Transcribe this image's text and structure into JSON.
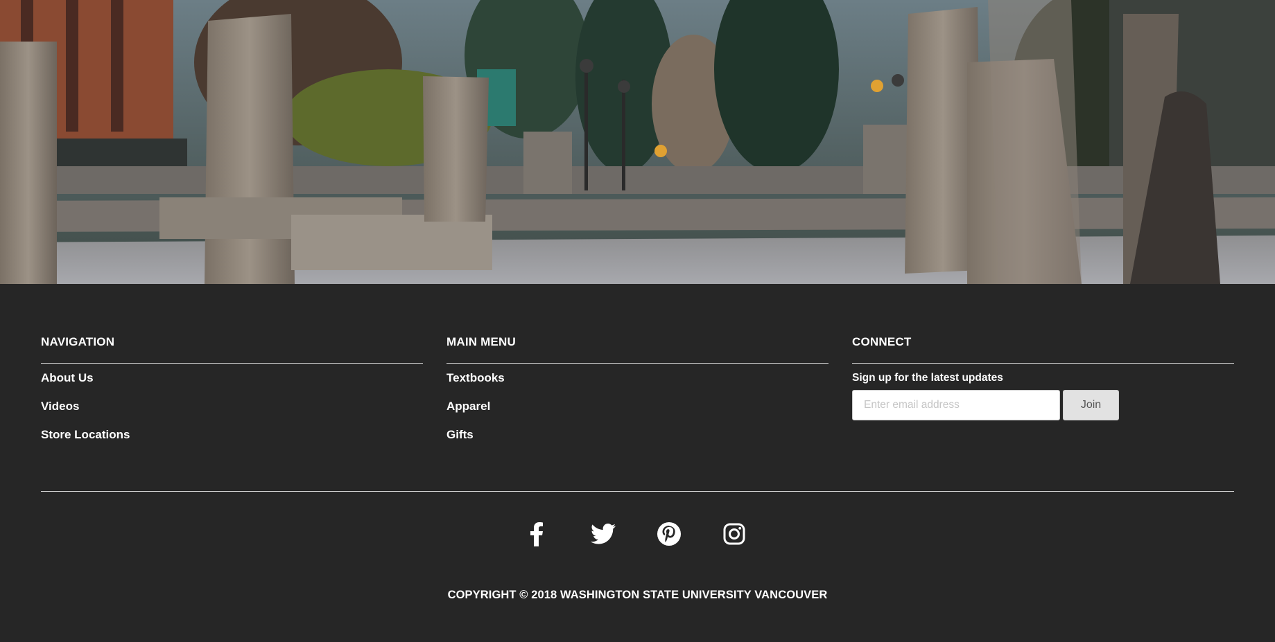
{
  "hero": {
    "image": "campus-stone-sculptures-photo"
  },
  "footer": {
    "navigation": {
      "heading": "NAVIGATION",
      "links": [
        "About Us",
        "Videos",
        "Store Locations"
      ]
    },
    "main_menu": {
      "heading": "MAIN MENU",
      "links": [
        "Textbooks",
        "Apparel",
        "Gifts"
      ]
    },
    "connect": {
      "heading": "CONNECT",
      "signup_text": "Sign up for the latest updates",
      "email_placeholder": "Enter email address",
      "email_value": "",
      "join_label": "Join"
    },
    "social": [
      "facebook-icon",
      "twitter-icon",
      "pinterest-icon",
      "instagram-icon"
    ],
    "copyright": "COPYRIGHT © 2018 WASHINGTON STATE UNIVERSITY VANCOUVER"
  },
  "colors": {
    "footer_bg": "#262626",
    "text": "#ffffff",
    "join_bg": "#e2e2e2"
  }
}
